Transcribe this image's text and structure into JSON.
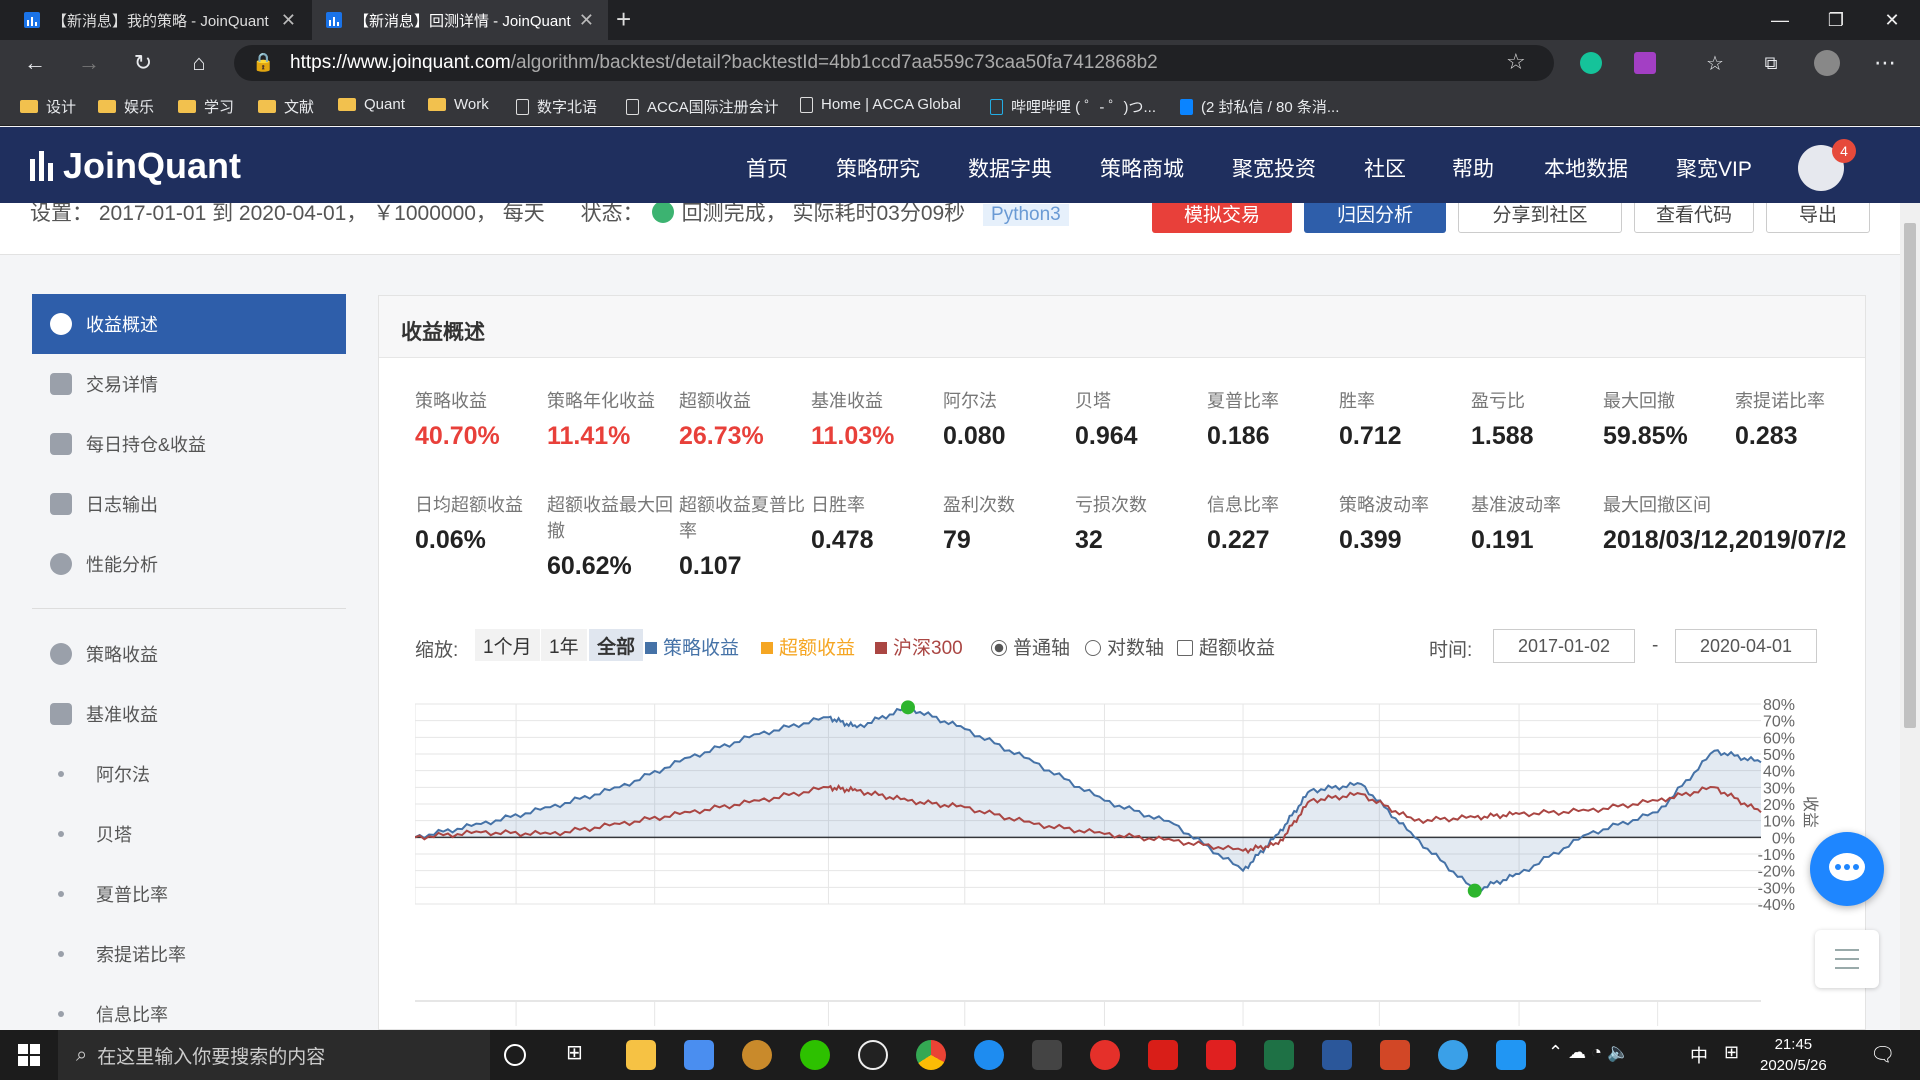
{
  "browser": {
    "tabs": [
      {
        "title": "【新消息】我的策略 - JoinQuant",
        "active": false
      },
      {
        "title": "【新消息】回测详情 - JoinQuant",
        "active": true
      }
    ],
    "url_host": "https://www.joinquant.com",
    "url_path": "/algorithm/backtest/detail?backtestId=4bb1ccd7aa559c73caa50fa7412868b2",
    "bookmarks": [
      {
        "label": "设计",
        "type": "folder"
      },
      {
        "label": "娱乐",
        "type": "folder"
      },
      {
        "label": "学习",
        "type": "folder"
      },
      {
        "label": "文献",
        "type": "folder"
      },
      {
        "label": "Quant",
        "type": "folder"
      },
      {
        "label": "Work",
        "type": "folder"
      },
      {
        "label": "数字北语",
        "type": "page"
      },
      {
        "label": "ACCA国际注册会计",
        "type": "page"
      },
      {
        "label": "Home | ACCA Global",
        "type": "page"
      },
      {
        "label": "哔哩哔哩 ( ゜- ゜)つ...",
        "type": "page"
      },
      {
        "label": "(2 封私信 / 80 条消...",
        "type": "page"
      }
    ]
  },
  "site": {
    "logo": "JoinQuant",
    "nav": [
      "首页",
      "策略研究",
      "数据字典",
      "策略商城",
      "聚宽投资",
      "社区",
      "帮助",
      "本地数据",
      "聚宽VIP"
    ],
    "notif_count": "4"
  },
  "subheader": {
    "settings": "设置： 2017-01-01 到 2020-04-01， ￥1000000， 每天",
    "status_label": "状态：",
    "status_text": "回测完成， 实际耗时03分09秒",
    "python_badge": "Python3",
    "buttons": [
      "模拟交易",
      "归因分析",
      "分享到社区",
      "查看代码",
      "导出"
    ]
  },
  "sidebar": {
    "items": [
      {
        "label": "收益概述",
        "active": true
      },
      {
        "label": "交易详情"
      },
      {
        "label": "每日持仓&收益"
      },
      {
        "label": "日志输出"
      },
      {
        "label": "性能分析"
      }
    ],
    "sub_items": [
      {
        "label": "策略收益"
      },
      {
        "label": "基准收益"
      },
      {
        "label": "阿尔法",
        "dot": true
      },
      {
        "label": "贝塔",
        "dot": true
      },
      {
        "label": "夏普比率",
        "dot": true
      },
      {
        "label": "索提诺比率",
        "dot": true
      },
      {
        "label": "信息比率",
        "dot": true
      }
    ]
  },
  "summary": {
    "title": "收益概述",
    "row1": [
      {
        "label": "策略收益",
        "value": "40.70%",
        "red": true
      },
      {
        "label": "策略年化收益",
        "value": "11.41%",
        "red": true
      },
      {
        "label": "超额收益",
        "value": "26.73%",
        "red": true
      },
      {
        "label": "基准收益",
        "value": "11.03%",
        "red": true
      },
      {
        "label": "阿尔法",
        "value": "0.080"
      },
      {
        "label": "贝塔",
        "value": "0.964"
      },
      {
        "label": "夏普比率",
        "value": "0.186"
      },
      {
        "label": "胜率",
        "value": "0.712"
      },
      {
        "label": "盈亏比",
        "value": "1.588"
      },
      {
        "label": "最大回撤",
        "value": "59.85%"
      },
      {
        "label": "索提诺比率",
        "value": "0.283"
      }
    ],
    "row2": [
      {
        "label": "日均超额收益",
        "value": "0.06%"
      },
      {
        "label": "超额收益最大回撤",
        "value": "60.62%"
      },
      {
        "label": "超额收益夏普比率",
        "value": "0.107"
      },
      {
        "label": "日胜率",
        "value": "0.478"
      },
      {
        "label": "盈利次数",
        "value": "79"
      },
      {
        "label": "亏损次数",
        "value": "32"
      },
      {
        "label": "信息比率",
        "value": "0.227"
      },
      {
        "label": "策略波动率",
        "value": "0.399"
      },
      {
        "label": "基准波动率",
        "value": "0.191"
      },
      {
        "label": "最大回撤区间",
        "value": "2018/03/12,2019/07/2"
      }
    ]
  },
  "chart_controls": {
    "zoom_label": "缩放:",
    "zoom_options": [
      "1个月",
      "1年",
      "全部"
    ],
    "legend": [
      {
        "label": "策略收益",
        "color": "#4572a7"
      },
      {
        "label": "超额收益",
        "color": "#f5a623"
      },
      {
        "label": "沪深300",
        "color": "#aa4643"
      }
    ],
    "axis_options": [
      "普通轴",
      "对数轴"
    ],
    "excess_checkbox": "超额收益",
    "time_label": "时间:",
    "date_from": "2017-01-02",
    "date_to": "2020-04-01",
    "range_sep": "-"
  },
  "chart_data": {
    "type": "line",
    "x_range": [
      "2017-01-02",
      "2020-04-01"
    ],
    "ylim": [
      -40,
      80
    ],
    "yticks": [
      "80%",
      "70%",
      "60%",
      "50%",
      "40%",
      "30%",
      "20%",
      "10%",
      "0%",
      "-10%",
      "-20%",
      "-30%",
      "-40%"
    ],
    "ylabel": "收益",
    "series": [
      {
        "name": "策略收益",
        "color": "#4572a7",
        "x": [
          "2017-01-02",
          "2017-03-01",
          "2017-05-01",
          "2017-07-01",
          "2017-09-01",
          "2017-11-01",
          "2018-01-01",
          "2018-01-26",
          "2018-03-12",
          "2018-05-01",
          "2018-07-01",
          "2018-09-01",
          "2018-11-01",
          "2019-01-01",
          "2019-02-01",
          "2019-03-01",
          "2019-04-15",
          "2019-06-01",
          "2019-07-24",
          "2019-09-01",
          "2019-11-01",
          "2020-01-01",
          "2020-02-20",
          "2020-04-01"
        ],
        "values": [
          0,
          8,
          18,
          30,
          48,
          62,
          72,
          66,
          78,
          65,
          45,
          22,
          8,
          -20,
          2,
          28,
          32,
          0,
          -32,
          -22,
          2,
          15,
          52,
          45
        ]
      },
      {
        "name": "沪深300",
        "color": "#aa4643",
        "x": [
          "2017-01-02",
          "2017-03-01",
          "2017-05-01",
          "2017-07-01",
          "2017-09-01",
          "2017-11-01",
          "2018-01-01",
          "2018-01-26",
          "2018-03-12",
          "2018-05-01",
          "2018-07-01",
          "2018-09-01",
          "2018-11-01",
          "2019-01-01",
          "2019-02-01",
          "2019-03-01",
          "2019-04-15",
          "2019-06-01",
          "2019-07-24",
          "2019-09-01",
          "2019-11-01",
          "2020-01-01",
          "2020-02-20",
          "2020-04-01"
        ],
        "values": [
          0,
          3,
          2,
          8,
          15,
          22,
          30,
          28,
          22,
          18,
          8,
          2,
          -2,
          -8,
          -4,
          22,
          26,
          10,
          12,
          14,
          16,
          22,
          30,
          15
        ]
      }
    ],
    "markers": [
      {
        "label": "max",
        "x": "2018-03-12",
        "value": 78,
        "color": "#2db52d"
      },
      {
        "label": "min",
        "x": "2019-07-24",
        "value": -32,
        "color": "#2db52d"
      }
    ]
  },
  "taskbar": {
    "search_placeholder": "在这里输入你要搜索的内容",
    "time": "21:45",
    "date": "2020/5/26",
    "ime": "中"
  }
}
